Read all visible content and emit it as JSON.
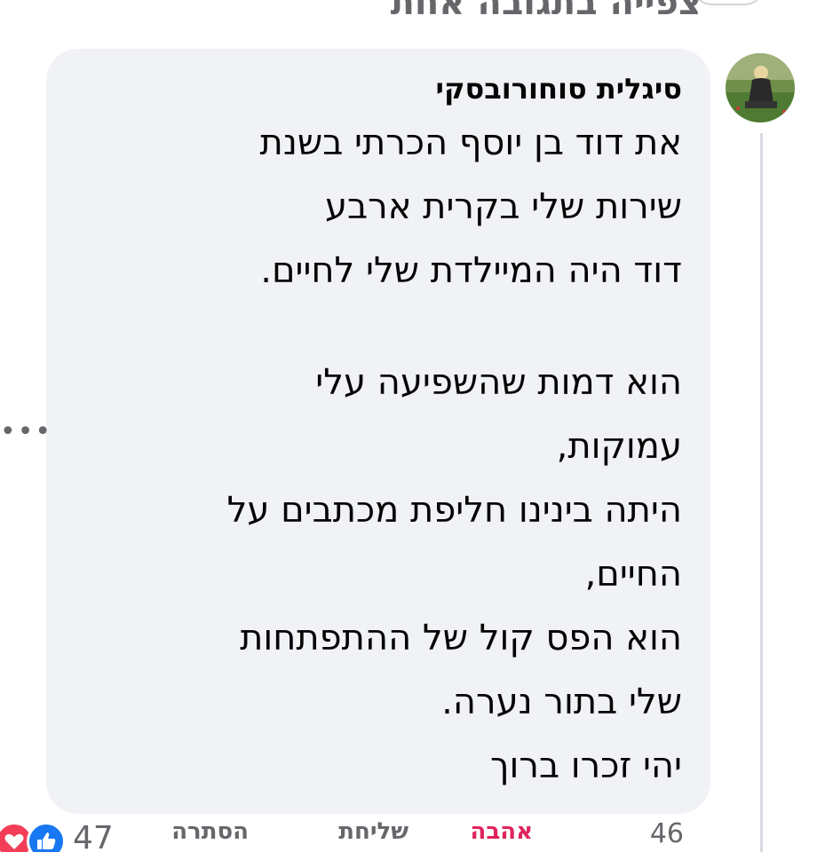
{
  "header": {
    "view_reply_label": "צפייה בתגובה אחת"
  },
  "comment": {
    "author": "סיגלית סוחורובסקי",
    "lines": [
      "את דוד בן יוסף הכרתי בשנת",
      "שירות שלי בקרית ארבע",
      "דוד היה המיילדת שלי לחיים.",
      "",
      "הוא דמות שהשפיעה עלי",
      "עמוקות,",
      "היתה בינינו חליפת מכתבים על",
      "החיים,",
      "הוא הפס קול של ההתפתחות",
      "שלי בתור נערה.",
      "יהי זכרו ברוך"
    ],
    "more_icon": "more-dots-icon"
  },
  "actions": {
    "time": "46",
    "love_label": "אהבה",
    "reply_label": "שליחת",
    "hide_label": "הסתרה"
  },
  "reactions": {
    "count": "47",
    "icons": [
      "heart-reaction-icon",
      "like-reaction-icon"
    ],
    "heart_color": "#f33e58",
    "like_color": "#1877f2"
  },
  "colors": {
    "bubble": "#f0f2f5",
    "secondary_text": "#65676b",
    "love_active": "#e0245e"
  }
}
